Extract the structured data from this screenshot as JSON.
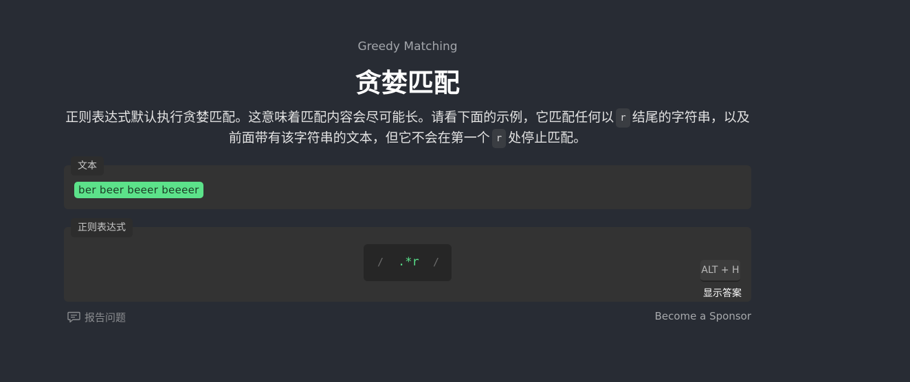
{
  "header": {
    "subtitle": "Greedy Matching",
    "title": "贪婪匹配"
  },
  "description": {
    "part1": "正则表达式默认执行贪婪匹配。这意味着匹配内容会尽可能长。请看下面的示例，它匹配任何以",
    "code1": "r",
    "part2": "结尾的字符串，以及前面带有该字符串的文本，但它不会在第一个",
    "code2": "r",
    "part3": "处停止匹配。"
  },
  "text_panel": {
    "label": "文本",
    "matched_text": "ber beer beeer beeeer"
  },
  "regex_panel": {
    "label": "正则表达式",
    "slash_left": "/",
    "value": ".*r",
    "slash_right": "/"
  },
  "hint": {
    "shortcut": "ALT + H",
    "label": "显示答案"
  },
  "footer": {
    "report_label": "报告问题",
    "report_icon": "comment-icon",
    "sponsor_label": "Become a Sponsor"
  },
  "colors": {
    "background": "#282c34",
    "panel": "#333333",
    "match_highlight": "#5ce28a",
    "regex_accent": "#59e08a"
  }
}
